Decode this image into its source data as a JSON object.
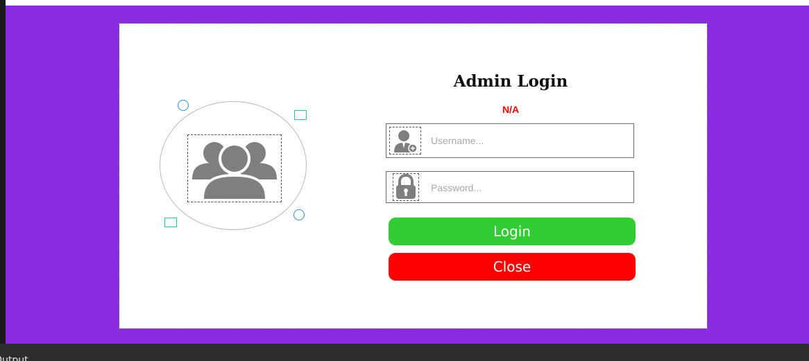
{
  "form": {
    "title": "Admin Login",
    "status": "N/A",
    "username": {
      "value": "",
      "placeholder": "Username..."
    },
    "password": {
      "value": "",
      "placeholder": "Password..."
    },
    "login_label": "Login",
    "close_label": "Close"
  },
  "output_panel": {
    "label": "Output"
  },
  "icons": {
    "avatar": "user-group-icon",
    "username": "user-icon",
    "password": "padlock-icon"
  },
  "colors": {
    "canvas_background": "#8a2be2",
    "form_background": "#ffffff",
    "status_text": "#ff0000",
    "login_button": "#32cd32",
    "close_button": "#ff0000",
    "selection_handle_circle": "#2d8fe0",
    "selection_handle_square": "#25d086",
    "icon_gray": "#7f7f7f"
  }
}
